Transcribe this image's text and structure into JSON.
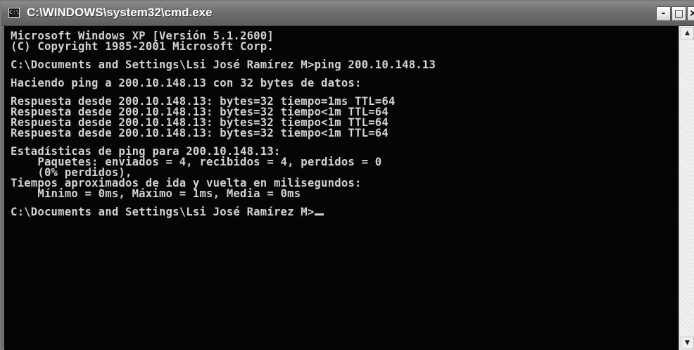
{
  "window": {
    "title": "C:\\WINDOWS\\system32\\cmd.exe",
    "app_icon": "cmd-icon",
    "app_icon_glyph": "C:\\",
    "buttons": {
      "minimize": "-",
      "maximize": "□",
      "close": "×"
    }
  },
  "console": {
    "lines": [
      "Microsoft Windows XP [Versión 5.1.2600]",
      "(C) Copyright 1985-2001 Microsoft Corp.",
      "",
      "C:\\Documents and Settings\\Lsi José Ramírez M>ping 200.10.148.13",
      "",
      "Haciendo ping a 200.10.148.13 con 32 bytes de datos:",
      "",
      "Respuesta desde 200.10.148.13: bytes=32 tiempo=1ms TTL=64",
      "Respuesta desde 200.10.148.13: bytes=32 tiempo<1m TTL=64",
      "Respuesta desde 200.10.148.13: bytes=32 tiempo<1m TTL=64",
      "Respuesta desde 200.10.148.13: bytes=32 tiempo<1m TTL=64",
      "",
      "Estadísticas de ping para 200.10.148.13:",
      "    Paquetes: enviados = 4, recibidos = 4, perdidos = 0",
      "    (0% perdidos),",
      "Tiempos aproximados de ida y vuelta en milisegundos:",
      "    Mínimo = 0ms, Máximo = 1ms, Media = 0ms",
      "",
      "C:\\Documents and Settings\\Lsi José Ramírez M>"
    ]
  },
  "scrollbar": {
    "up_arrow": "▲",
    "down_arrow": "▼"
  },
  "colors": {
    "console_background": "#050505",
    "console_text": "#d2d2d2",
    "titlebar": "#6e6e6e"
  }
}
